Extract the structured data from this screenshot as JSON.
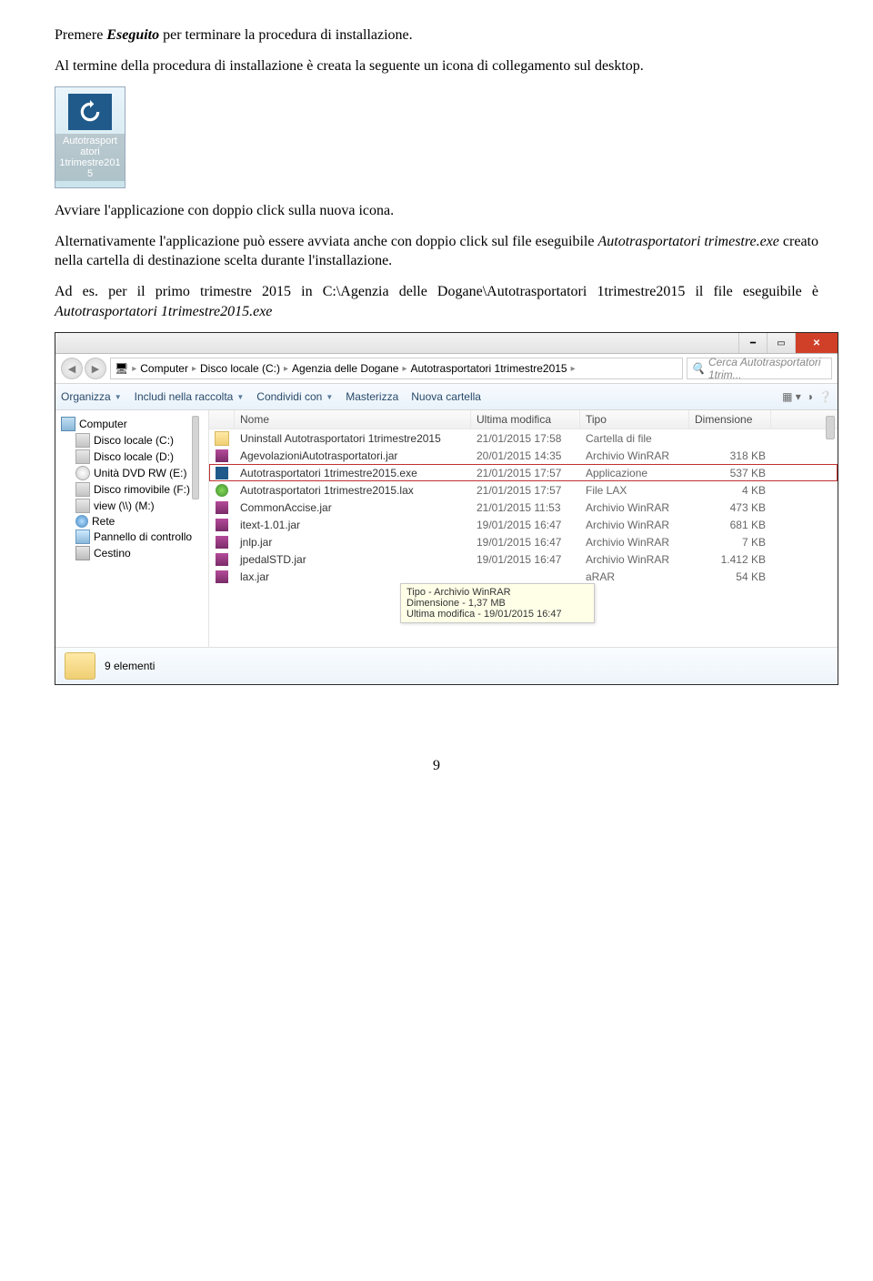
{
  "doc": {
    "p1_pre": "Premere ",
    "p1_cmd": "Eseguito",
    "p1_post": " per terminare la procedura di installazione.",
    "p2": "Al termine della procedura di installazione è creata la seguente un icona di collegamento sul desktop.",
    "p3": "Avviare l'applicazione con doppio click sulla nuova icona.",
    "p4_a": "Alternativamente l'applicazione può essere avviata anche con doppio click sul file eseguibile ",
    "p4_b": "Autotrasportatori trimestre.exe",
    "p4_c": " creato nella cartella di destinazione scelta durante l'installazione.",
    "p5_a": "Ad es. per il primo trimestre 2015 in C:\\Agenzia delle Dogane\\Autotrasportatori 1trimestre2015 il file eseguibile è ",
    "p5_b": "Autotrasportatori 1trimestre2015.exe",
    "page_no": "9"
  },
  "desktop_icon": {
    "line1": "Autotrasport",
    "line2": "atori",
    "line3": "1trimestre201",
    "line4": "5"
  },
  "explorer": {
    "breadcrumb": [
      "Computer",
      "Disco locale (C:)",
      "Agenzia delle Dogane",
      "Autotrasportatori 1trimestre2015"
    ],
    "search_placeholder": "Cerca Autotrasportatori 1trim...",
    "toolbar": {
      "organizza": "Organizza",
      "includi": "Includi nella raccolta",
      "condividi": "Condividi con",
      "masterizza": "Masterizza",
      "nuova": "Nuova cartella"
    },
    "columns": {
      "nome": "Nome",
      "ultima": "Ultima modifica",
      "tipo": "Tipo",
      "dim": "Dimensione"
    },
    "tree": {
      "root": "Computer",
      "items": [
        {
          "label": "Disco locale (C:)",
          "ico": "drive"
        },
        {
          "label": "Disco locale (D:)",
          "ico": "drive"
        },
        {
          "label": "Unità DVD RW (E:)",
          "ico": "cd"
        },
        {
          "label": "Disco rimovibile (F:)",
          "ico": "drive"
        },
        {
          "label": "view (\\\\) (M:)",
          "ico": "drive"
        },
        {
          "label": "Rete",
          "ico": "net"
        },
        {
          "label": "Pannello di controllo",
          "ico": "ctrl"
        },
        {
          "label": "Cestino",
          "ico": "trash"
        }
      ]
    },
    "rows": [
      {
        "ico": "folder",
        "name": "Uninstall Autotrasportatori 1trimestre2015",
        "mod": "21/01/2015 17:58",
        "tipo": "Cartella di file",
        "dim": ""
      },
      {
        "ico": "rar",
        "name": "AgevolazioniAutotrasportatori.jar",
        "mod": "20/01/2015 14:35",
        "tipo": "Archivio WinRAR",
        "dim": "318 KB"
      },
      {
        "ico": "exe",
        "name": "Autotrasportatori 1trimestre2015.exe",
        "mod": "21/01/2015 17:57",
        "tipo": "Applicazione",
        "dim": "537 KB",
        "selected": true
      },
      {
        "ico": "lax",
        "name": "Autotrasportatori 1trimestre2015.lax",
        "mod": "21/01/2015 17:57",
        "tipo": "File LAX",
        "dim": "4 KB"
      },
      {
        "ico": "rar",
        "name": "CommonAccise.jar",
        "mod": "21/01/2015 11:53",
        "tipo": "Archivio WinRAR",
        "dim": "473 KB"
      },
      {
        "ico": "rar",
        "name": "itext-1.01.jar",
        "mod": "19/01/2015 16:47",
        "tipo": "Archivio WinRAR",
        "dim": "681 KB"
      },
      {
        "ico": "rar",
        "name": "jnlp.jar",
        "mod": "19/01/2015 16:47",
        "tipo": "Archivio WinRAR",
        "dim": "7 KB"
      },
      {
        "ico": "rar",
        "name": "jpedalSTD.jar",
        "mod": "19/01/2015 16:47",
        "tipo": "Archivio WinRAR",
        "dim": "1.412 KB"
      },
      {
        "ico": "rar",
        "name": "lax.jar",
        "mod": "",
        "tipo": "aRAR",
        "dim": "54 KB"
      }
    ],
    "tooltip": {
      "l1": "Tipo - Archivio WinRAR",
      "l2": "Dimensione - 1,37 MB",
      "l3": "Ultima modifica - 19/01/2015 16:47"
    },
    "status": "9 elementi"
  }
}
